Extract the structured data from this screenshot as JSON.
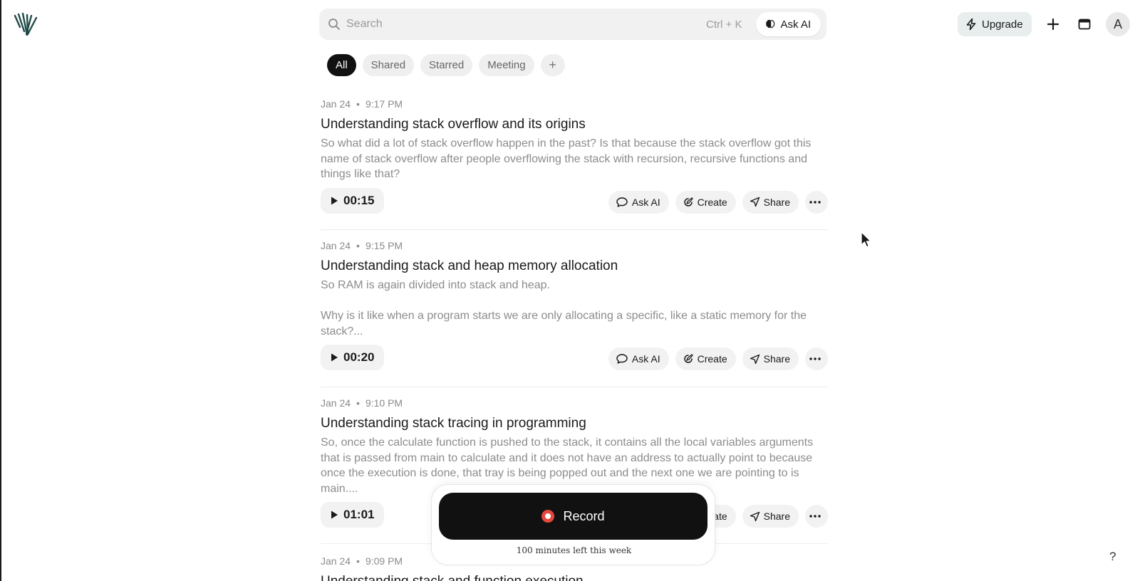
{
  "search": {
    "placeholder": "Search",
    "shortcut": "Ctrl + K",
    "ask_ai": "Ask AI"
  },
  "header": {
    "upgrade": "Upgrade",
    "avatar_letter": "A"
  },
  "filters": [
    {
      "label": "All",
      "active": true
    },
    {
      "label": "Shared",
      "active": false
    },
    {
      "label": "Starred",
      "active": false
    },
    {
      "label": "Meeting",
      "active": false
    }
  ],
  "add_filter": "+",
  "notes": [
    {
      "date": "Jan 24",
      "time": "9:17 PM",
      "title": "Understanding stack overflow and its origins",
      "excerpt": "So what did a lot of stack overflow happen in the past? Is that because the stack overflow got this name of stack overflow after people overflowing the stack with recursion, recursive functions and things like that?",
      "duration": "00:15"
    },
    {
      "date": "Jan 24",
      "time": "9:15 PM",
      "title": "Understanding stack and heap memory allocation",
      "excerpt": "So RAM is again divided into stack and heap.\n\nWhy is it like when a program starts we are only allocating a specific, like a static memory for the stack?...",
      "duration": "00:20"
    },
    {
      "date": "Jan 24",
      "time": "9:10 PM",
      "title": "Understanding stack tracing in programming",
      "excerpt": "So, once the calculate function is pushed to the stack, it contains all the local variables arguments that is passed from main to calculate and it does not have an address to actually point to because once the execution is done, that tray is being popped out and the next one we are pointing to is main....",
      "duration": "01:01"
    },
    {
      "date": "Jan 24",
      "time": "9:09 PM",
      "title": "Understanding stack and function execution",
      "excerpt": "",
      "duration": ""
    }
  ],
  "actions": {
    "ask_ai": "Ask AI",
    "create": "Create",
    "share": "Share"
  },
  "recorder": {
    "label": "Record",
    "minutes_left": "100 minutes left this week"
  },
  "help": "?",
  "colors": {
    "record_dot": "#e8473f",
    "accent_dark": "#111111",
    "upgrade_bg": "#e8eded"
  }
}
